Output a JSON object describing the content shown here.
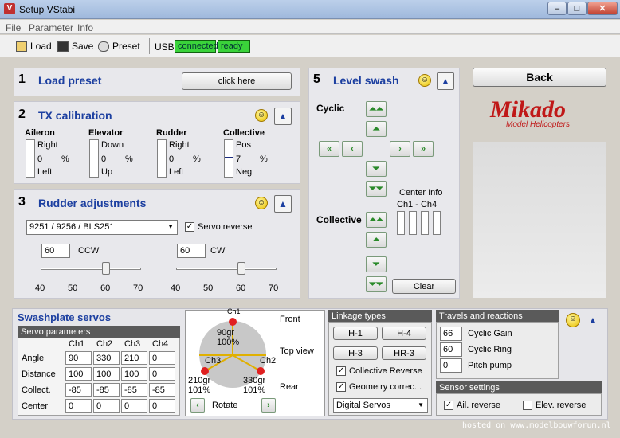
{
  "window": {
    "title": "Setup VStabi"
  },
  "menu": [
    "File",
    "Parameter",
    "Info"
  ],
  "toolbar": {
    "load": "Load",
    "save": "Save",
    "preset": "Preset",
    "usb": "USB",
    "connected": "connected",
    "ready": "ready"
  },
  "p1": {
    "num": "1",
    "title": "Load preset",
    "button": "click here"
  },
  "p2": {
    "num": "2",
    "title": "TX calibration",
    "channels": [
      {
        "name": "Aileron",
        "top": "Right",
        "value": "0",
        "unit": "%",
        "bottom": "Left",
        "fill": 0
      },
      {
        "name": "Elevator",
        "top": "Down",
        "value": "0",
        "unit": "%",
        "bottom": "Up",
        "fill": 0
      },
      {
        "name": "Rudder",
        "top": "Right",
        "value": "0",
        "unit": "%",
        "bottom": "Left",
        "fill": 0
      },
      {
        "name": "Collective",
        "top": "Pos",
        "value": "7",
        "unit": "%",
        "bottom": "Neg",
        "fill": 7
      }
    ]
  },
  "p3": {
    "num": "3",
    "title": "Rudder adjustments",
    "select": "9251 / 9256 / BLS251",
    "servo_reverse": "Servo reverse",
    "ccw_value": "60",
    "ccw": "CCW",
    "cw_value": "60",
    "cw": "CW",
    "ticks": [
      "40",
      "50",
      "60",
      "70"
    ]
  },
  "p5": {
    "num": "5",
    "title": "Level swash",
    "cyclic": "Cyclic",
    "collective": "Collective",
    "center_info": "Center Info",
    "center_ch": "Ch1 - Ch4",
    "clear": "Clear"
  },
  "back": "Back",
  "logo": {
    "main": "Mikado",
    "sub": "Model Helicopters"
  },
  "swash": {
    "title": "Swashplate servos",
    "params": "Servo parameters",
    "cols": [
      "Ch1",
      "Ch2",
      "Ch3",
      "Ch4"
    ],
    "rows": [
      {
        "label": "Angle",
        "vals": [
          "90",
          "330",
          "210",
          "0"
        ]
      },
      {
        "label": "Distance",
        "vals": [
          "100",
          "100",
          "100",
          "0"
        ]
      },
      {
        "label": "Collect.",
        "vals": [
          "-85",
          "-85",
          "-85",
          "-85"
        ]
      },
      {
        "label": "Center",
        "vals": [
          "0",
          "0",
          "0",
          "0"
        ]
      }
    ]
  },
  "topview": {
    "front": "Front",
    "top": "Top view",
    "rear": "Rear",
    "rotate": "Rotate",
    "s1a": "90gr",
    "s1b": "100%",
    "s2a": "330gr",
    "s2b": "101%",
    "s3a": "210gr",
    "s3b": "101%",
    "ch3": "Ch3",
    "ch2": "Ch2",
    "ch1": "Ch1"
  },
  "linkage": {
    "title": "Linkage types",
    "h1": "H-1",
    "h4": "H-4",
    "h3": "H-3",
    "hr3": "HR-3",
    "coll_rev": "Collective Reverse",
    "geom": "Geometry correc...",
    "servo_type": "Digital Servos"
  },
  "travels": {
    "title": "Travels and reactions",
    "cg_val": "66",
    "cg": "Cyclic Gain",
    "cr_val": "60",
    "cr": "Cyclic Ring",
    "pp_val": "0",
    "pp": "Pitch pump"
  },
  "sensor": {
    "title": "Sensor settings",
    "ail": "Ail. reverse",
    "elev": "Elev. reverse"
  },
  "watermark": "hosted on www.modelbouwforum.nl"
}
